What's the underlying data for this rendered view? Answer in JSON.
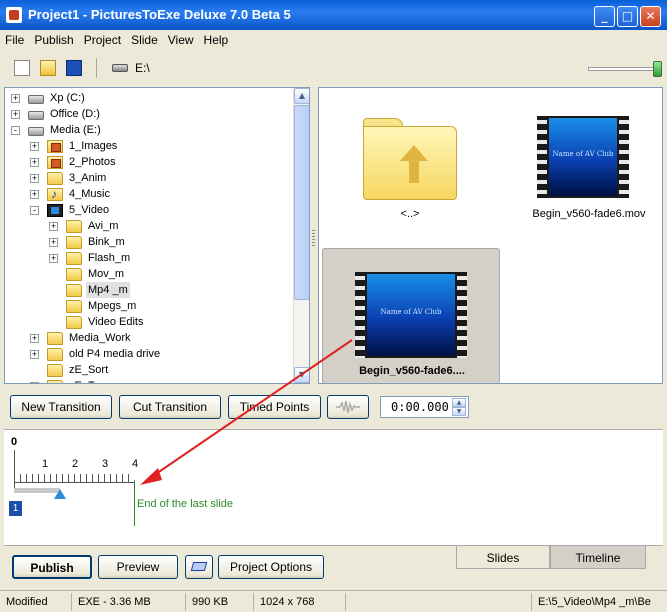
{
  "window": {
    "title": "Project1 - PicturesToExe Deluxe 7.0 Beta 5"
  },
  "menu": [
    "File",
    "Publish",
    "Project",
    "Slide",
    "View",
    "Help"
  ],
  "toolbar": {
    "path": "E:\\"
  },
  "tree": [
    {
      "label": "Xp (C:)",
      "icon": "drive-icon"
    },
    {
      "label": "Office (D:)",
      "icon": "drive-icon"
    },
    {
      "label": "Media (E:)",
      "icon": "drive-icon"
    },
    {
      "label": "1_Images",
      "icon": "image-folder-icon"
    },
    {
      "label": "2_Photos",
      "icon": "image-folder-icon"
    },
    {
      "label": "3_Anim",
      "icon": "folder-icon"
    },
    {
      "label": "4_Music",
      "icon": "music-folder-icon"
    },
    {
      "label": "5_Video",
      "icon": "film-folder-icon"
    },
    {
      "label": "Avi_m",
      "icon": "folder-icon"
    },
    {
      "label": "Bink_m",
      "icon": "folder-icon"
    },
    {
      "label": "Flash_m",
      "icon": "folder-icon"
    },
    {
      "label": "Mov_m",
      "icon": "folder-icon"
    },
    {
      "label": "Mp4 _m",
      "icon": "folder-icon"
    },
    {
      "label": "Mpegs_m",
      "icon": "folder-icon"
    },
    {
      "label": "Video Edits",
      "icon": "folder-icon"
    },
    {
      "label": "Media_Work",
      "icon": "folder-icon"
    },
    {
      "label": "old P4 media drive",
      "icon": "folder-icon"
    },
    {
      "label": "zE_Sort",
      "icon": "folder-icon"
    },
    {
      "label": "zE_Temp",
      "icon": "folder-icon"
    }
  ],
  "files": [
    {
      "caption": "<..>"
    },
    {
      "caption": "Begin_v560-fade6.mov",
      "thumb_text": "Name of AV Club"
    },
    {
      "caption": "Begin_v560-fade6....",
      "thumb_text": "Name of AV Club"
    }
  ],
  "actions": {
    "new_transition": "New Transition",
    "cut_transition": "Cut Transition",
    "timed_points": "Timed Points",
    "time_value": "0:00.000"
  },
  "timeline": {
    "ticks": [
      "0",
      "1",
      "2",
      "3",
      "4"
    ],
    "end_label": "End of the last slide",
    "slide_number": "1"
  },
  "bottom": {
    "publish": "Publish",
    "preview": "Preview",
    "project_options": "Project Options",
    "tab_slides": "Slides",
    "tab_timeline": "Timeline"
  },
  "status": [
    "Modified",
    "EXE - 3.36 MB",
    "990 KB",
    "1024 x 768",
    "E:\\5_Video\\Mp4 _m\\Be"
  ],
  "colors": {
    "arrow": "#e02020",
    "end_marker": "#2a8a2a",
    "slide_badge": "#1c4fa8"
  }
}
